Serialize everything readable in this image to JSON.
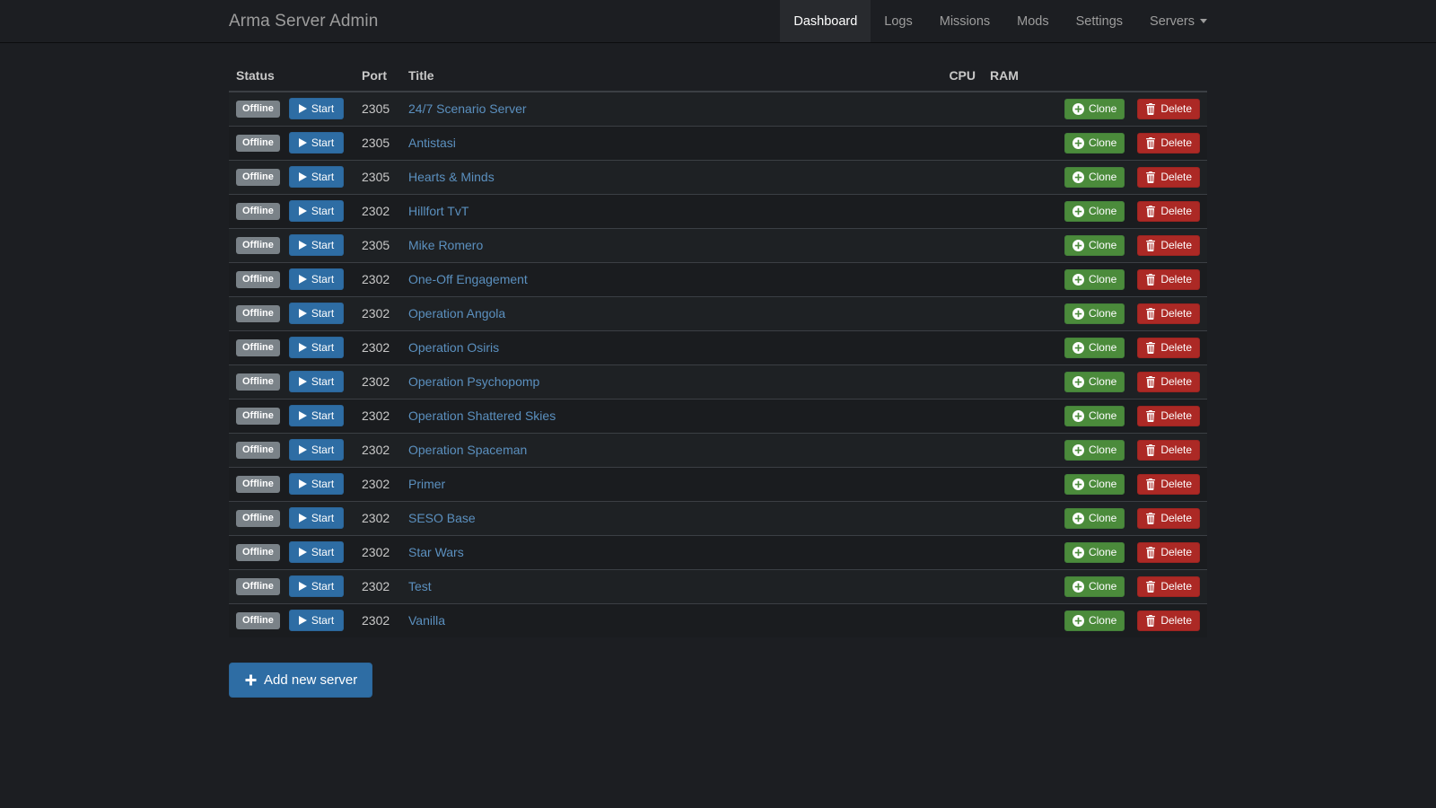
{
  "navbar": {
    "brand": "Arma Server Admin",
    "items": [
      {
        "label": "Dashboard",
        "active": true,
        "caret": false
      },
      {
        "label": "Logs",
        "active": false,
        "caret": false
      },
      {
        "label": "Missions",
        "active": false,
        "caret": false
      },
      {
        "label": "Mods",
        "active": false,
        "caret": false
      },
      {
        "label": "Settings",
        "active": false,
        "caret": false
      },
      {
        "label": "Servers",
        "active": false,
        "caret": true
      }
    ]
  },
  "table": {
    "headers": {
      "status": "Status",
      "port": "Port",
      "title": "Title",
      "cpu": "CPU",
      "ram": "RAM",
      "actions": ""
    },
    "buttons": {
      "start": "Start",
      "clone": "Clone",
      "delete": "Delete",
      "status_offline": "Offline"
    },
    "rows": [
      {
        "status": "Offline",
        "start": "Start",
        "port": "2305",
        "title": "24/7 Scenario Server",
        "cpu": "",
        "ram": "",
        "clone": "Clone",
        "delete": "Delete"
      },
      {
        "status": "Offline",
        "start": "Start",
        "port": "2305",
        "title": "Antistasi",
        "cpu": "",
        "ram": "",
        "clone": "Clone",
        "delete": "Delete"
      },
      {
        "status": "Offline",
        "start": "Start",
        "port": "2305",
        "title": "Hearts & Minds",
        "cpu": "",
        "ram": "",
        "clone": "Clone",
        "delete": "Delete"
      },
      {
        "status": "Offline",
        "start": "Start",
        "port": "2302",
        "title": "Hillfort TvT",
        "cpu": "",
        "ram": "",
        "clone": "Clone",
        "delete": "Delete"
      },
      {
        "status": "Offline",
        "start": "Start",
        "port": "2305",
        "title": "Mike Romero",
        "cpu": "",
        "ram": "",
        "clone": "Clone",
        "delete": "Delete"
      },
      {
        "status": "Offline",
        "start": "Start",
        "port": "2302",
        "title": "One-Off Engagement",
        "cpu": "",
        "ram": "",
        "clone": "Clone",
        "delete": "Delete"
      },
      {
        "status": "Offline",
        "start": "Start",
        "port": "2302",
        "title": "Operation Angola",
        "cpu": "",
        "ram": "",
        "clone": "Clone",
        "delete": "Delete"
      },
      {
        "status": "Offline",
        "start": "Start",
        "port": "2302",
        "title": "Operation Osiris",
        "cpu": "",
        "ram": "",
        "clone": "Clone",
        "delete": "Delete"
      },
      {
        "status": "Offline",
        "start": "Start",
        "port": "2302",
        "title": "Operation Psychopomp",
        "cpu": "",
        "ram": "",
        "clone": "Clone",
        "delete": "Delete"
      },
      {
        "status": "Offline",
        "start": "Start",
        "port": "2302",
        "title": "Operation Shattered Skies",
        "cpu": "",
        "ram": "",
        "clone": "Clone",
        "delete": "Delete"
      },
      {
        "status": "Offline",
        "start": "Start",
        "port": "2302",
        "title": "Operation Spaceman",
        "cpu": "",
        "ram": "",
        "clone": "Clone",
        "delete": "Delete"
      },
      {
        "status": "Offline",
        "start": "Start",
        "port": "2302",
        "title": "Primer",
        "cpu": "",
        "ram": "",
        "clone": "Clone",
        "delete": "Delete"
      },
      {
        "status": "Offline",
        "start": "Start",
        "port": "2302",
        "title": "SESO Base",
        "cpu": "",
        "ram": "",
        "clone": "Clone",
        "delete": "Delete"
      },
      {
        "status": "Offline",
        "start": "Start",
        "port": "2302",
        "title": "Star Wars",
        "cpu": "",
        "ram": "",
        "clone": "Clone",
        "delete": "Delete"
      },
      {
        "status": "Offline",
        "start": "Start",
        "port": "2302",
        "title": "Test",
        "cpu": "",
        "ram": "",
        "clone": "Clone",
        "delete": "Delete"
      },
      {
        "status": "Offline",
        "start": "Start",
        "port": "2302",
        "title": "Vanilla",
        "cpu": "",
        "ram": "",
        "clone": "Clone",
        "delete": "Delete"
      }
    ]
  },
  "footer": {
    "add_server": "Add new server"
  },
  "icons": {
    "start": "play-icon",
    "clone": "plus-circle-icon",
    "delete": "trash-icon",
    "add": "plus-icon",
    "servers_dropdown": "chevron-down-icon"
  },
  "colors": {
    "page_background": "#1c1e22",
    "navbar_background": "#1c1e22",
    "navbar_active": "#282a2e",
    "row_odd": "#1e2124",
    "row_even": "#1a1c1f",
    "border": "#3b3f44",
    "link": "#5b90bf",
    "primary": "#2e6da4",
    "success": "#4b8b3b",
    "danger": "#ac2925",
    "muted": "#7a8288",
    "text": "#c8c8c8"
  }
}
